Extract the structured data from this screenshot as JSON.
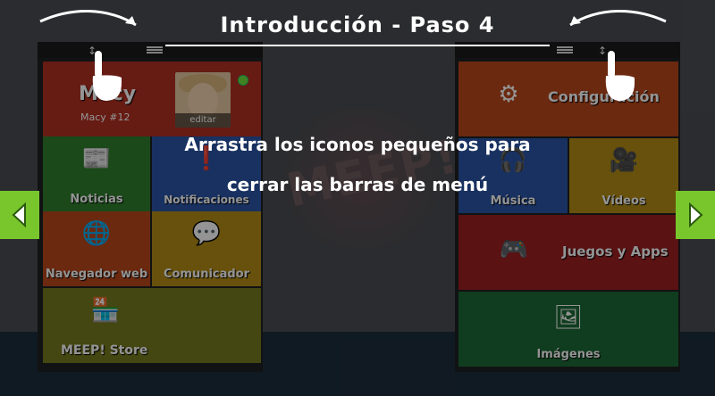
{
  "tutorial": {
    "title": "Introducción - Paso 4",
    "instruction_line1": "Arrastra los iconos pequeños para",
    "instruction_line2": "cerrar las barras de menú"
  },
  "background": {
    "logo_text": "MEEP!"
  },
  "left_panel": {
    "profile": {
      "name": "Macy",
      "id": "Macy #12",
      "edit_label": "editar"
    },
    "tiles": [
      {
        "label": "Noticias",
        "icon": "newspaper-icon"
      },
      {
        "label": "Notificaciones",
        "icon": "exclamation-icon"
      },
      {
        "label": "Navegador web",
        "icon": "globe-icon"
      },
      {
        "label": "Comunicador",
        "icon": "chat-bubbles-icon"
      },
      {
        "label": "MEEP! Store",
        "icon": "store-icon"
      }
    ]
  },
  "right_panel": {
    "tiles": [
      {
        "label": "Configuración",
        "icon": "gears-icon"
      },
      {
        "label": "Música",
        "icon": "headphones-icon"
      },
      {
        "label": "Vídeos",
        "icon": "video-camera-icon"
      },
      {
        "label": "Juegos y Apps",
        "icon": "gamepad-icon"
      },
      {
        "label": "Imágenes",
        "icon": "image-icon"
      }
    ]
  },
  "colors": {
    "nav_arrow": "#79c62c",
    "status_online": "#6ee03c"
  }
}
